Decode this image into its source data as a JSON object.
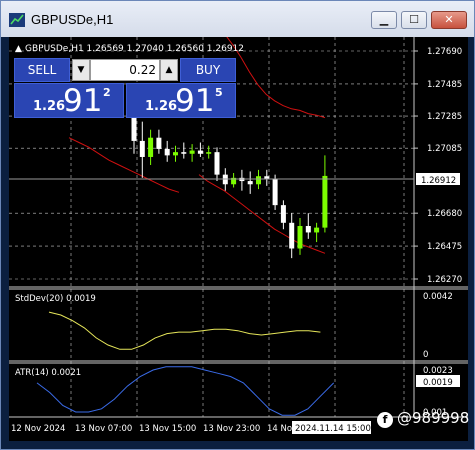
{
  "window": {
    "title": "GBPUSDe,H1"
  },
  "controls": {
    "minimize": "▁",
    "maximize": "☐",
    "close": "✕"
  },
  "colors": {
    "background": "#000000",
    "grid": "#c8c8c8",
    "bull_candle": "#7CFC00",
    "bear_candle": "#ffffff",
    "bollinger": "#d01010",
    "stddev": "#e6e65a",
    "atr": "#3a6be8",
    "panel_blue": "#2a45b3"
  },
  "chart": {
    "header": "GBPUSDe,H1  1.26569 1.27040 1.26560 1.26912",
    "current_price": "1.26912",
    "price_ticks": [
      "1.27690",
      "1.27485",
      "1.27285",
      "1.27085",
      "1.26680",
      "1.26475",
      "1.26270"
    ],
    "time_labels": [
      "12 Nov 2024",
      "13 Nov 07:00",
      "13 Nov 15:00",
      "13 Nov 23:00",
      "14 No"
    ],
    "crosshair_time": "2024.11.14 15:00"
  },
  "trade_panel": {
    "sell_label": "SELL",
    "buy_label": "BUY",
    "lot": "0.22",
    "lot_down": "▼",
    "lot_up": "▲",
    "sell_price": {
      "prefix": "1.26",
      "big": "91",
      "sup": "2"
    },
    "buy_price": {
      "prefix": "1.26",
      "big": "91",
      "sup": "5"
    }
  },
  "indicators": {
    "stddev": {
      "label": "StdDev(20) 0.0019",
      "ticks": [
        "0.0042",
        "0"
      ]
    },
    "atr": {
      "label": "ATR(14) 0.0021",
      "current": "0.0019",
      "ticks": [
        "0.0023",
        "0.001"
      ]
    }
  },
  "watermark": {
    "icon": "f",
    "text": "@989998"
  },
  "chart_data": {
    "type": "candlestick",
    "candles": [
      {
        "o": 1.2728,
        "h": 1.274,
        "l": 1.2705,
        "c": 1.2713
      },
      {
        "o": 1.2713,
        "h": 1.2725,
        "l": 1.269,
        "c": 1.2703
      },
      {
        "o": 1.2703,
        "h": 1.272,
        "l": 1.2698,
        "c": 1.2715
      },
      {
        "o": 1.2715,
        "h": 1.272,
        "l": 1.2705,
        "c": 1.2708
      },
      {
        "o": 1.2708,
        "h": 1.2713,
        "l": 1.27,
        "c": 1.2704
      },
      {
        "o": 1.2704,
        "h": 1.271,
        "l": 1.27,
        "c": 1.2706
      },
      {
        "o": 1.2706,
        "h": 1.2712,
        "l": 1.2702,
        "c": 1.2705
      },
      {
        "o": 1.2705,
        "h": 1.2711,
        "l": 1.27,
        "c": 1.2707
      },
      {
        "o": 1.2707,
        "h": 1.2712,
        "l": 1.2703,
        "c": 1.2705
      },
      {
        "o": 1.2705,
        "h": 1.271,
        "l": 1.2702,
        "c": 1.2706
      },
      {
        "o": 1.2706,
        "h": 1.2709,
        "l": 1.2688,
        "c": 1.2692
      },
      {
        "o": 1.2692,
        "h": 1.2696,
        "l": 1.2682,
        "c": 1.2686
      },
      {
        "o": 1.2686,
        "h": 1.2693,
        "l": 1.2684,
        "c": 1.269
      },
      {
        "o": 1.269,
        "h": 1.2695,
        "l": 1.2682,
        "c": 1.2688
      },
      {
        "o": 1.2688,
        "h": 1.2694,
        "l": 1.268,
        "c": 1.2686
      },
      {
        "o": 1.2686,
        "h": 1.2695,
        "l": 1.2683,
        "c": 1.2691
      },
      {
        "o": 1.2691,
        "h": 1.2695,
        "l": 1.2685,
        "c": 1.2689
      },
      {
        "o": 1.2689,
        "h": 1.2692,
        "l": 1.267,
        "c": 1.2673
      },
      {
        "o": 1.2673,
        "h": 1.2676,
        "l": 1.2658,
        "c": 1.2662
      },
      {
        "o": 1.2662,
        "h": 1.2668,
        "l": 1.264,
        "c": 1.2646
      },
      {
        "o": 1.2646,
        "h": 1.2665,
        "l": 1.2642,
        "c": 1.266
      },
      {
        "o": 1.266,
        "h": 1.2668,
        "l": 1.2652,
        "c": 1.2656
      },
      {
        "o": 1.2656,
        "h": 1.2662,
        "l": 1.265,
        "c": 1.2659
      },
      {
        "o": 1.2659,
        "h": 1.2704,
        "l": 1.2656,
        "c": 1.26912
      }
    ],
    "bollinger_upper": [
      1.2799,
      1.2793,
      1.2787,
      1.278,
      1.2773,
      1.2765,
      1.2756,
      1.2748,
      1.2742,
      1.2738,
      1.2735,
      1.2733,
      1.2732,
      1.273,
      1.2729,
      1.27275
    ],
    "bollinger_lower": [
      1.2692,
      1.2688,
      1.2685,
      1.2682,
      1.2678,
      1.2674,
      1.267,
      1.2666,
      1.2662,
      1.2658,
      1.2655,
      1.2652,
      1.2649,
      1.2647,
      1.2645,
      1.2643
    ],
    "bollinger_mid": [
      1.2715,
      1.2712,
      1.2709,
      1.2705,
      1.2701,
      1.2698,
      1.2695,
      1.2692,
      1.2689,
      1.2686,
      1.2683,
      1.2681
    ],
    "stddev": [
      0.003,
      0.0028,
      0.0024,
      0.0019,
      0.0012,
      0.0007,
      0.0004,
      0.0004,
      0.0007,
      0.0012,
      0.0015,
      0.0016,
      0.0016,
      0.0017,
      0.0018,
      0.0018,
      0.0017,
      0.0015,
      0.0014,
      0.0015,
      0.0016,
      0.0017,
      0.0017,
      0.0016
    ],
    "atr": [
      0.0019,
      0.0016,
      0.0012,
      0.001,
      0.001,
      0.0011,
      0.0014,
      0.0018,
      0.0021,
      0.0023,
      0.0024,
      0.0024,
      0.0024,
      0.0023,
      0.0022,
      0.0021,
      0.0019,
      0.0015,
      0.0011,
      0.0009,
      0.0009,
      0.0011,
      0.0015,
      0.0019
    ]
  }
}
